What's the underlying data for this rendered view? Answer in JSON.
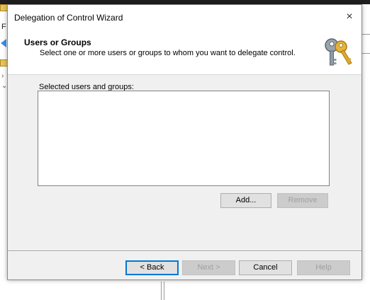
{
  "background": {
    "letter": "F"
  },
  "dialog": {
    "title": "Delegation of Control Wizard",
    "close_label": "×",
    "header": {
      "title": "Users or Groups",
      "subtitle": "Select one or more users or groups to whom you want to delegate control."
    },
    "list_label": "Selected users and groups:",
    "selected_items": [],
    "buttons": {
      "add": "Add...",
      "remove": "Remove",
      "back": "< Back",
      "next": "Next >",
      "cancel": "Cancel",
      "help": "Help"
    },
    "icon": "keys-icon"
  }
}
